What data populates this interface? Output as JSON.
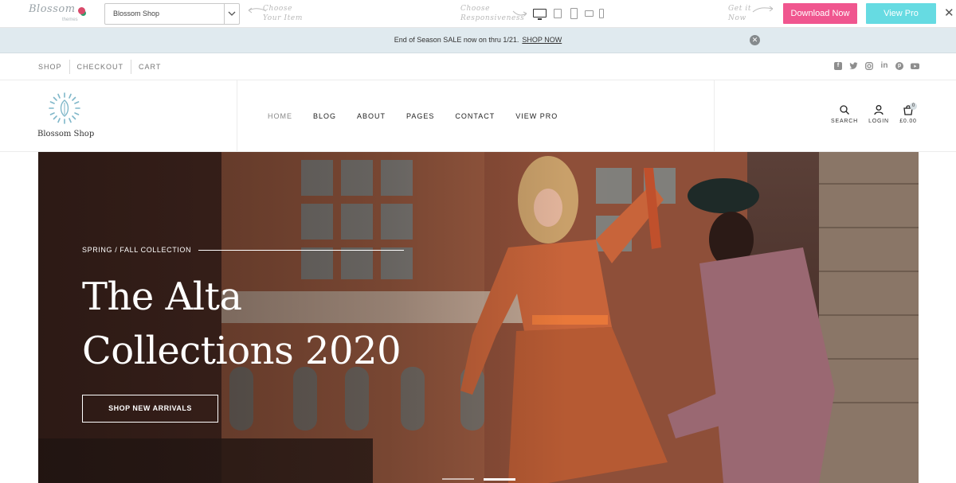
{
  "demo_bar": {
    "logo_text": "Blossom",
    "logo_sub": "themes",
    "theme_select_value": "Blossom Shop",
    "hint_choose_item": "Choose Your Item",
    "hint_responsive": "Choose Responsiveness",
    "hint_get_it": "Get it Now",
    "download_label": "Download Now",
    "viewpro_label": "View Pro",
    "close_glyph": "✕",
    "download_color": "#f0568f",
    "viewpro_color": "#66dbe2"
  },
  "announcement": {
    "text": "End of Season SALE now on thru 1/21.",
    "link": "SHOP NOW",
    "close_glyph": "✕"
  },
  "utility_nav": {
    "links": [
      "SHOP",
      "CHECKOUT",
      "CART"
    ],
    "socials": [
      "facebook-icon",
      "twitter-icon",
      "instagram-icon",
      "linkedin-icon",
      "pinterest-icon",
      "youtube-icon"
    ]
  },
  "header": {
    "brand_name": "Blossom Shop",
    "nav": [
      "HOME",
      "BLOG",
      "ABOUT",
      "PAGES",
      "CONTACT",
      "VIEW PRO"
    ],
    "search_label": "SEARCH",
    "login_label": "LOGIN",
    "cart_label": "£0.00",
    "cart_count": "0"
  },
  "hero": {
    "eyebrow": "SPRING / FALL COLLECTION",
    "headline_line1": "The Alta",
    "headline_line2": "Collections 2020",
    "cta_label": "SHOP NEW ARRIVALS",
    "slide_active": 2,
    "slide_count": 2
  }
}
